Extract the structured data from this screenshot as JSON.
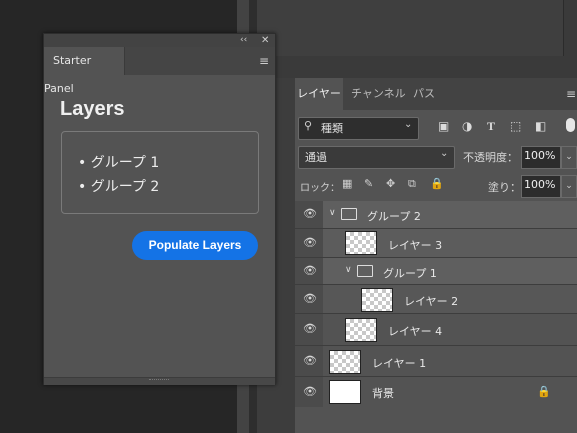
{
  "starter_panel": {
    "tab_label": "Starter Panel",
    "heading": "Layers",
    "items": [
      "• グループ 1",
      "• グループ 2"
    ],
    "button_label": "Populate Layers",
    "collapse_glyph": "‹‹",
    "close_glyph": "✕",
    "menu_glyph": "≡",
    "accent": "#1473e6"
  },
  "layers_panel": {
    "tabs": [
      "レイヤー",
      "チャンネル",
      "パス"
    ],
    "menu_glyph": "≡",
    "filter": {
      "label": "種類",
      "search_glyph": "🔍"
    },
    "blend_mode": "通過",
    "opacity_label": "不透明度：",
    "opacity_value": "100%",
    "lock_label": "ロック：",
    "fill_label": "塗り：",
    "fill_value": "100%",
    "lock_glyph": "🔒",
    "layers": [
      {
        "name": "グループ 2",
        "type": "group",
        "depth": 0
      },
      {
        "name": "レイヤー 3",
        "type": "layer",
        "depth": 1
      },
      {
        "name": "グループ 1",
        "type": "group",
        "depth": 1
      },
      {
        "name": "レイヤー 2",
        "type": "layer",
        "depth": 2
      },
      {
        "name": "レイヤー 4",
        "type": "layer",
        "depth": 1
      },
      {
        "name": "レイヤー 1",
        "type": "layer",
        "depth": 0
      },
      {
        "name": "背景",
        "type": "background",
        "depth": 0,
        "locked": true
      }
    ]
  }
}
